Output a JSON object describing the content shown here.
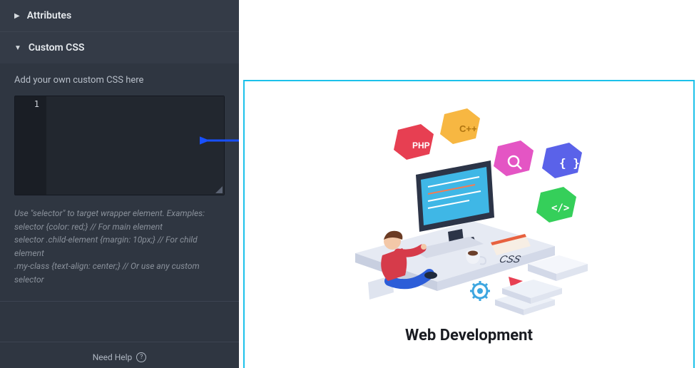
{
  "sidebar": {
    "sections": {
      "attributes": {
        "label": "Attributes",
        "expanded": false
      },
      "custom_css": {
        "label": "Custom CSS",
        "expanded": true,
        "description": "Add your own custom CSS here",
        "editor": {
          "line_number": "1",
          "value": ""
        },
        "hint": "Use \"selector\" to target wrapper element. Examples:\nselector {color: red;} // For main element\nselector .child-element {margin: 10px;} // For child element\n.my-class {text-align: center;} // Or use any custom selector"
      }
    },
    "footer": {
      "help_label": "Need Help",
      "help_icon": "?"
    }
  },
  "canvas": {
    "caption": "Web Development",
    "illustration": {
      "alt": "Isometric illustration of a developer at a desk with computer, coffee, notebook, gear icon, CSS paper stacks, and floating program language badges",
      "badges": {
        "php": {
          "label": "PHP",
          "color": "#e73f52"
        },
        "cpp": {
          "label": "C++",
          "color": "#f7b742"
        },
        "search": {
          "color": "#e455c4"
        },
        "braces": {
          "label": "{ }",
          "color": "#5a62e9"
        },
        "slash": {
          "label": "</>",
          "color": "#35cf5a"
        }
      },
      "css_paper": {
        "label": "CSS"
      },
      "gear_color": "#3da6e0"
    }
  }
}
